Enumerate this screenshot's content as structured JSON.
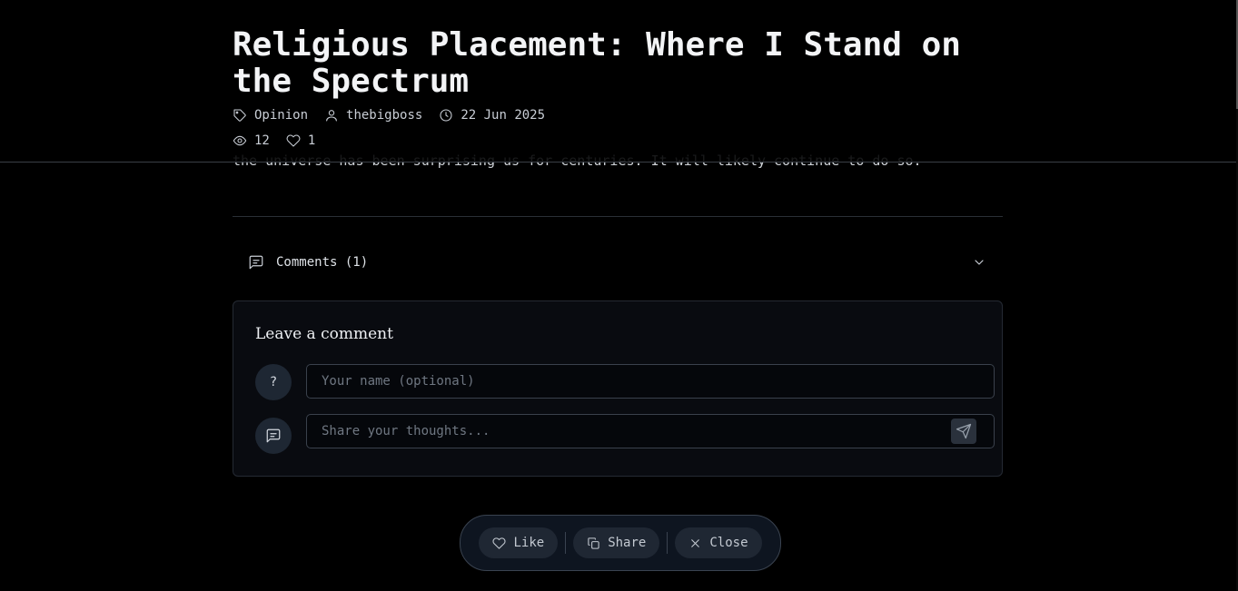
{
  "article": {
    "title": "Religious Placement: Where I Stand on the Spectrum",
    "category": "Opinion",
    "author": "thebigboss",
    "date": "22 Jun 2025",
    "views": "12",
    "likes": "1",
    "visible_text_last_line": "the universe has been surprising us for centuries. It will likely continue to do so."
  },
  "comments": {
    "toggle_label": "Comments (1)",
    "form_title": "Leave a comment",
    "avatar_placeholder": "?",
    "name_placeholder": "Your name (optional)",
    "message_placeholder": "Share your thoughts..."
  },
  "actions": {
    "like_label": "Like",
    "share_label": "Share",
    "close_label": "Close"
  },
  "icons": {
    "category": "tag-icon",
    "author": "user-icon",
    "date": "clock-icon",
    "views": "eye-icon",
    "likes": "heart-icon",
    "comments": "message-square-icon",
    "expand": "chevron-down-icon",
    "send": "send-icon",
    "share": "copy-icon",
    "close": "x-icon"
  },
  "colors": {
    "background": "#000000",
    "card": "#090b10",
    "action_button": "#1f2733",
    "avatar": "#1e2733"
  }
}
